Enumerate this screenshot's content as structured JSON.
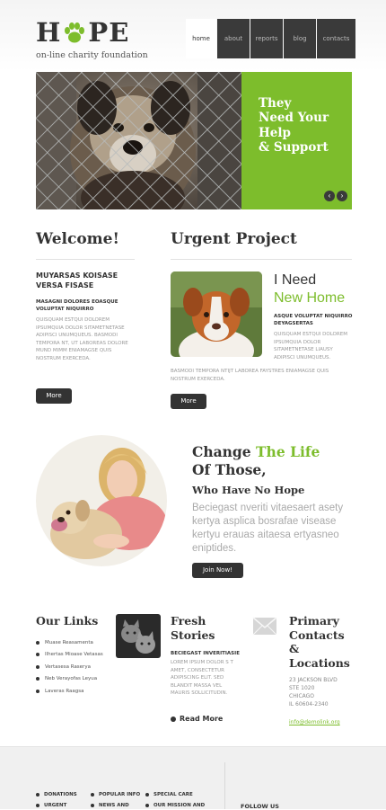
{
  "header": {
    "logo_left": "H",
    "logo_right": "PE",
    "logo_icon": "paw-icon",
    "tagline": "on-line charity foundation"
  },
  "nav": [
    "home",
    "about",
    "reports",
    "blog",
    "contacts"
  ],
  "hero": {
    "caption": "They\nNeed Your\nHelp\n& Support",
    "prev_icon": "arrow-left-icon",
    "next_icon": "arrow-right-icon",
    "prev_glyph": "‹",
    "next_glyph": "›",
    "accent_color": "#7dbd2c"
  },
  "welcome": {
    "heading": "Welcome!",
    "subtitle": "MUYARSAS KOISASE VERSA FISASE",
    "intro": "MASAGNI DOLORES EOASQUE VOLUPTAT NIQUIRRO",
    "body": "QUISQUAM ESTQUI DOLOREM IPSUMQUIA DOLOR SITAMETNETASE ADIPISCI UNUMQUEUS. BASMODI TEMPORA NT, UT LABOREAS DOLORE MUND MIMM ENIAMAGSE QUIS NOSTRUM EXERCEDA.",
    "button": "More"
  },
  "urgent": {
    "heading": "Urgent Project",
    "title_line1": "I Need",
    "title_line2": "New Home",
    "intro": "ASQUE VOLUPTAT NIQUIRRO DEYAGSERTAS",
    "body_right": "QUISQUAM ESTQUI DOLOREM IPSUMQUIA DOLOR SITAMETNETASE LIAUSY ADIPISCI UNUMQUEUS.",
    "body_full": "BASMODI TEMPORA NTIJT LABOREA FAYSTRES ENIAMAGSE QUIS NOSTRUM EXERCEDA.",
    "button": "More"
  },
  "change": {
    "line1_a": "Change ",
    "line1_b": "The Life",
    "line2": "Of Those,",
    "sub": "Who Have No Hope",
    "body": "Beciegast nveriti vitaesaert asety kertya asplica bosrafae visease kertyu erauas aitaesa ertyasneo eniptides.",
    "button": "Join Now!"
  },
  "links": {
    "heading": "Our Links",
    "items": [
      "Muase Reasamenta",
      "Ilhertas Mioase Vetasas",
      "Vertasesa Raserya",
      "Neb Verayofas Leyua",
      "Laveras Raagsa"
    ]
  },
  "fresh": {
    "heading_line1": "Fresh",
    "heading_line2": "Stories",
    "subtitle": "BECIEGAST INVERITIASIE",
    "body": "LOREM IPSUM DOLOR S T AMET, CONSECTETUR ADIPISCING ELIT. SED BLANDIT MASSA VEL MAURIS SOLLICITUDIN.",
    "read_more": "Read More"
  },
  "contacts": {
    "heading_line1": "Primary",
    "heading_line2": "Contacts",
    "heading_line3": "&",
    "heading_line4": "Locations",
    "address1": "23 JACKSON BLVD",
    "address2": "STE 1020",
    "address3": "CHICAGO",
    "address4": "IL 60604-2340",
    "email": "info@demolink.org"
  },
  "footer": {
    "col1": [
      "DONATIONS",
      "URGENT"
    ],
    "col2": [
      "POPULAR INFO",
      "NEWS AND"
    ],
    "col3": [
      "SPECIAL CARE",
      "OUR MISSION AND"
    ],
    "follow": "FOLLOW US"
  }
}
